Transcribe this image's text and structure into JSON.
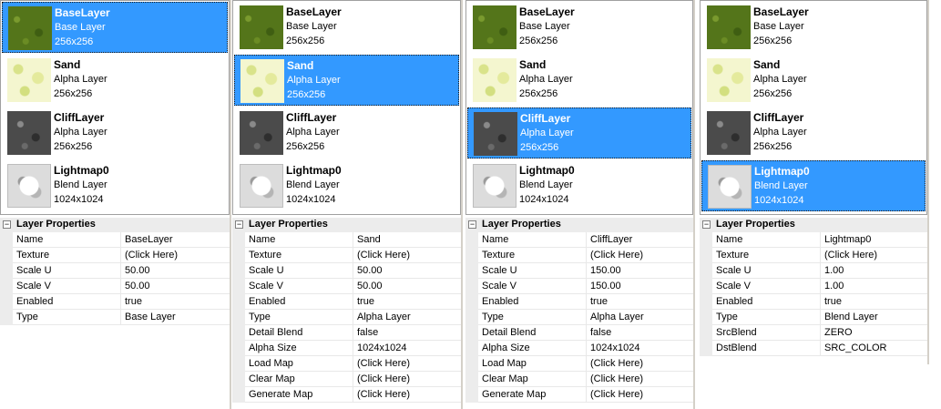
{
  "colors": {
    "selection": "#3399ff",
    "gutter": "#ececec"
  },
  "panels": [
    {
      "selected_index": 0,
      "layers": [
        {
          "thumb": "grass-texture",
          "name": "BaseLayer",
          "type": "Base Layer",
          "size": "256x256"
        },
        {
          "thumb": "sand-texture",
          "name": "Sand",
          "type": "Alpha Layer",
          "size": "256x256"
        },
        {
          "thumb": "cliff-texture",
          "name": "CliffLayer",
          "type": "Alpha Layer",
          "size": "256x256"
        },
        {
          "thumb": "lightmap-texture",
          "name": "Lightmap0",
          "type": "Blend Layer",
          "size": "1024x1024"
        }
      ],
      "properties_title": "Layer Properties",
      "properties": [
        {
          "key": "Name",
          "value": "BaseLayer"
        },
        {
          "key": "Texture",
          "value": "(Click Here)"
        },
        {
          "key": "Scale U",
          "value": "50.00"
        },
        {
          "key": "Scale V",
          "value": "50.00"
        },
        {
          "key": "Enabled",
          "value": "true"
        },
        {
          "key": "Type",
          "value": "Base Layer"
        }
      ]
    },
    {
      "selected_index": 1,
      "layers": [
        {
          "thumb": "grass-texture",
          "name": "BaseLayer",
          "type": "Base Layer",
          "size": "256x256"
        },
        {
          "thumb": "sand-texture",
          "name": "Sand",
          "type": "Alpha Layer",
          "size": "256x256"
        },
        {
          "thumb": "cliff-texture",
          "name": "CliffLayer",
          "type": "Alpha Layer",
          "size": "256x256"
        },
        {
          "thumb": "lightmap-texture",
          "name": "Lightmap0",
          "type": "Blend Layer",
          "size": "1024x1024"
        }
      ],
      "properties_title": "Layer Properties",
      "properties": [
        {
          "key": "Name",
          "value": "Sand"
        },
        {
          "key": "Texture",
          "value": "(Click Here)"
        },
        {
          "key": "Scale U",
          "value": "50.00"
        },
        {
          "key": "Scale V",
          "value": "50.00"
        },
        {
          "key": "Enabled",
          "value": "true"
        },
        {
          "key": "Type",
          "value": "Alpha Layer"
        },
        {
          "key": "Detail Blend",
          "value": "false"
        },
        {
          "key": "Alpha Size",
          "value": "1024x1024"
        },
        {
          "key": "Load Map",
          "value": "(Click Here)"
        },
        {
          "key": "Clear Map",
          "value": "(Click Here)"
        },
        {
          "key": "Generate Map",
          "value": "(Click Here)"
        }
      ]
    },
    {
      "selected_index": 2,
      "layers": [
        {
          "thumb": "grass-texture",
          "name": "BaseLayer",
          "type": "Base Layer",
          "size": "256x256"
        },
        {
          "thumb": "sand-texture",
          "name": "Sand",
          "type": "Alpha Layer",
          "size": "256x256"
        },
        {
          "thumb": "cliff-texture",
          "name": "CliffLayer",
          "type": "Alpha Layer",
          "size": "256x256"
        },
        {
          "thumb": "lightmap-texture",
          "name": "Lightmap0",
          "type": "Blend Layer",
          "size": "1024x1024"
        }
      ],
      "properties_title": "Layer Properties",
      "properties": [
        {
          "key": "Name",
          "value": "CliffLayer"
        },
        {
          "key": "Texture",
          "value": "(Click Here)"
        },
        {
          "key": "Scale U",
          "value": "150.00"
        },
        {
          "key": "Scale V",
          "value": "150.00"
        },
        {
          "key": "Enabled",
          "value": "true"
        },
        {
          "key": "Type",
          "value": "Alpha Layer"
        },
        {
          "key": "Detail Blend",
          "value": "false"
        },
        {
          "key": "Alpha Size",
          "value": "1024x1024"
        },
        {
          "key": "Load Map",
          "value": "(Click Here)"
        },
        {
          "key": "Clear Map",
          "value": "(Click Here)"
        },
        {
          "key": "Generate Map",
          "value": "(Click Here)"
        }
      ]
    },
    {
      "selected_index": 3,
      "layers": [
        {
          "thumb": "grass-texture",
          "name": "BaseLayer",
          "type": "Base Layer",
          "size": "256x256"
        },
        {
          "thumb": "sand-texture",
          "name": "Sand",
          "type": "Alpha Layer",
          "size": "256x256"
        },
        {
          "thumb": "cliff-texture",
          "name": "CliffLayer",
          "type": "Alpha Layer",
          "size": "256x256"
        },
        {
          "thumb": "lightmap-texture",
          "name": "Lightmap0",
          "type": "Blend Layer",
          "size": "1024x1024"
        }
      ],
      "properties_title": "Layer Properties",
      "properties": [
        {
          "key": "Name",
          "value": "Lightmap0"
        },
        {
          "key": "Texture",
          "value": "(Click Here)"
        },
        {
          "key": "Scale U",
          "value": "1.00"
        },
        {
          "key": "Scale V",
          "value": "1.00"
        },
        {
          "key": "Enabled",
          "value": "true"
        },
        {
          "key": "Type",
          "value": "Blend Layer"
        },
        {
          "key": "SrcBlend",
          "value": "ZERO"
        },
        {
          "key": "DstBlend",
          "value": "SRC_COLOR"
        }
      ]
    }
  ]
}
